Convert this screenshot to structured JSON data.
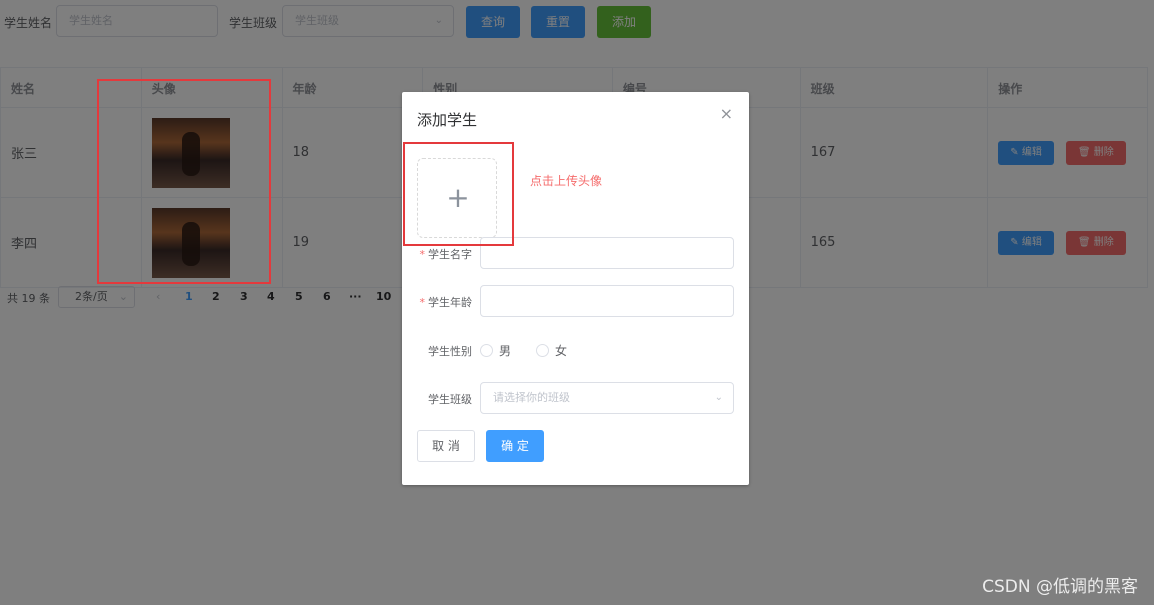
{
  "search": {
    "name_label": "学生姓名",
    "name_placeholder": "学生姓名",
    "class_label": "学生班级",
    "class_placeholder": "学生班级",
    "query_btn": "查询",
    "reset_btn": "重置",
    "add_btn": "添加"
  },
  "table": {
    "headers": [
      "姓名",
      "头像",
      "年龄",
      "性别",
      "编号",
      "班级",
      "操作"
    ],
    "rows": [
      {
        "name": "张三",
        "age": "18",
        "class": "167"
      },
      {
        "name": "李四",
        "age": "19",
        "class": "165"
      }
    ],
    "edit_label": "✎ 编辑",
    "delete_label": "🗑 删除"
  },
  "pager": {
    "total": "共 19 条",
    "page_size": "2条/页",
    "prev": "‹",
    "pages": [
      "1",
      "2",
      "3",
      "4",
      "5",
      "6",
      "···",
      "10"
    ],
    "current": "1"
  },
  "dialog": {
    "title": "添加学生",
    "close": "×",
    "upload_plus": "+",
    "upload_hint": "点击上传头像",
    "fields": {
      "name_label": "学生名字",
      "age_label": "学生年龄",
      "gender_label": "学生性别",
      "gender_male": "男",
      "gender_female": "女",
      "class_label": "学生班级",
      "class_placeholder": "请选择你的班级"
    },
    "cancel": "取 消",
    "ok": "确 定"
  },
  "watermark": "CSDN @低调的黑客",
  "colors": {
    "primary": "#409eff",
    "success": "#67c23a",
    "danger": "#f56c6c",
    "annotation": "#e4393c"
  }
}
